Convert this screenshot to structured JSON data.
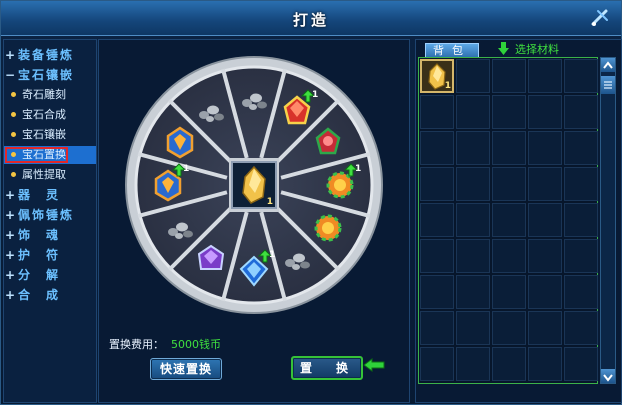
{
  "window": {
    "title": "打造"
  },
  "sidebar": {
    "items": [
      {
        "label": "装备锤炼",
        "prefix": "+",
        "kind": "top"
      },
      {
        "label": "宝石镶嵌",
        "prefix": "−",
        "kind": "top"
      },
      {
        "label": "奇石雕刻",
        "kind": "sub"
      },
      {
        "label": "宝石合成",
        "kind": "sub"
      },
      {
        "label": "宝石镶嵌",
        "kind": "sub"
      },
      {
        "label": "宝石置换",
        "kind": "sub",
        "selected": true
      },
      {
        "label": "属性提取",
        "kind": "sub"
      },
      {
        "label": "器　灵",
        "prefix": "+",
        "kind": "top"
      },
      {
        "label": "佩饰锤炼",
        "prefix": "+",
        "kind": "top"
      },
      {
        "label": "饰　魂",
        "prefix": "+",
        "kind": "top"
      },
      {
        "label": "护　符",
        "prefix": "+",
        "kind": "top"
      },
      {
        "label": "分　解",
        "prefix": "+",
        "kind": "top"
      },
      {
        "label": "合　成",
        "prefix": "+",
        "kind": "top"
      }
    ]
  },
  "wheel": {
    "slots": [
      {
        "gem": "red-gold",
        "count": "1",
        "upgrade": true
      },
      {
        "gem": "red-green",
        "count": "",
        "upgrade": false
      },
      {
        "gem": "orange-gear",
        "count": "1",
        "upgrade": true
      },
      {
        "gem": "orange-gear",
        "count": "",
        "upgrade": false
      },
      {
        "gem": "empty-rubble",
        "count": "",
        "upgrade": false
      },
      {
        "gem": "blue-sapphire",
        "count": "1",
        "upgrade": true
      },
      {
        "gem": "purple-amethyst",
        "count": "",
        "upgrade": false
      },
      {
        "gem": "empty-rubble",
        "count": "",
        "upgrade": false
      },
      {
        "gem": "orange-blue",
        "count": "1",
        "upgrade": true
      },
      {
        "gem": "orange-blue",
        "count": "",
        "upgrade": false
      },
      {
        "gem": "empty-rubble",
        "count": "",
        "upgrade": false
      },
      {
        "gem": "empty-rubble",
        "count": "",
        "upgrade": false
      }
    ],
    "center": {
      "item": "gold-ore",
      "count": "1"
    }
  },
  "cost": {
    "label": "置换费用：",
    "value": "5000钱币"
  },
  "buttons": {
    "quick": "快速置换",
    "swap": "置　换"
  },
  "bag": {
    "tab": "背包",
    "hint": "选择材料",
    "items": [
      {
        "item": "gold-ore",
        "count": "1"
      }
    ]
  },
  "colors": {
    "accent": "#1d6fd0",
    "highlight_green": "#3fe03f",
    "selection_border": "#e0282a"
  }
}
